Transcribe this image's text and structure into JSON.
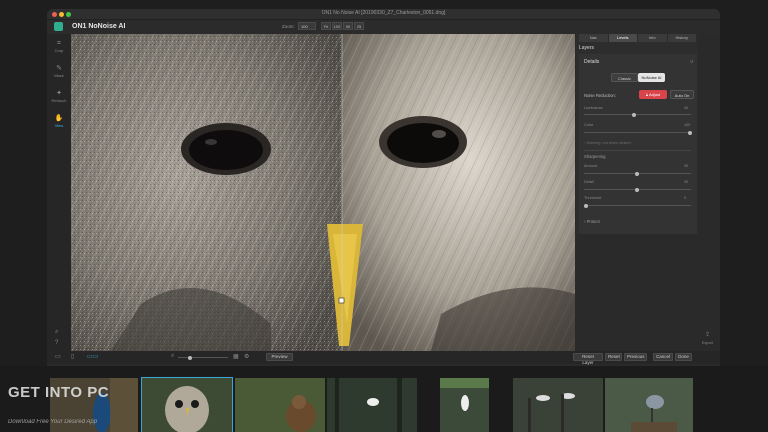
{
  "window": {
    "title": "ON1 No Noise AI [20190330_Z7_Charleston_0051.dng]"
  },
  "app": {
    "name": "ON1 NoNoise AI"
  },
  "zoom": {
    "label": "Zoom:",
    "value": "100",
    "buttons": [
      "Fit",
      "100",
      "50",
      "25"
    ]
  },
  "toolbar": {
    "items": [
      {
        "icon": "crop-icon",
        "glyph": "⌗",
        "label": "Crop"
      },
      {
        "icon": "brush-icon",
        "glyph": "✎",
        "label": "Mask"
      },
      {
        "icon": "retouch-icon",
        "glyph": "✦",
        "label": "Retouch"
      },
      {
        "icon": "view-icon",
        "glyph": "✋",
        "label": "View"
      }
    ]
  },
  "panel": {
    "tabs": [
      "Nav",
      "Levels",
      "Info",
      "History"
    ],
    "layers_label": "Layers",
    "details_label": "Details",
    "modes": [
      "Classic",
      "NoNoise AI"
    ],
    "noise_reduction_label": "Noise Reduction:",
    "adjust_label": "Adjust",
    "auto_label": "Auto On",
    "luminance_label": "Luminance",
    "luminance_value": "40",
    "color_label": "Color",
    "color_value": "100",
    "warning_text": "Warning: not when related",
    "sharpening_label": "Sharpening",
    "amount_label": "Amount",
    "amount_value": "30",
    "detail_label": "Detail",
    "detail_value": "30",
    "threshold_label": "Threshold",
    "threshold_value": "0",
    "protect_label": "Protect"
  },
  "bottombar": {
    "preview_label": "Preview",
    "buttons": [
      "Reset Layer",
      "Reset",
      "Previous",
      "Cancel",
      "Done"
    ]
  },
  "export": {
    "label": "Export"
  },
  "watermark": {
    "title": "GET INTO PC",
    "subtitle": "Download Free Your Desired App"
  },
  "colors": {
    "accent": "#3aa7d8",
    "brand": "#2fae8f",
    "adjust": "#d9434a"
  }
}
